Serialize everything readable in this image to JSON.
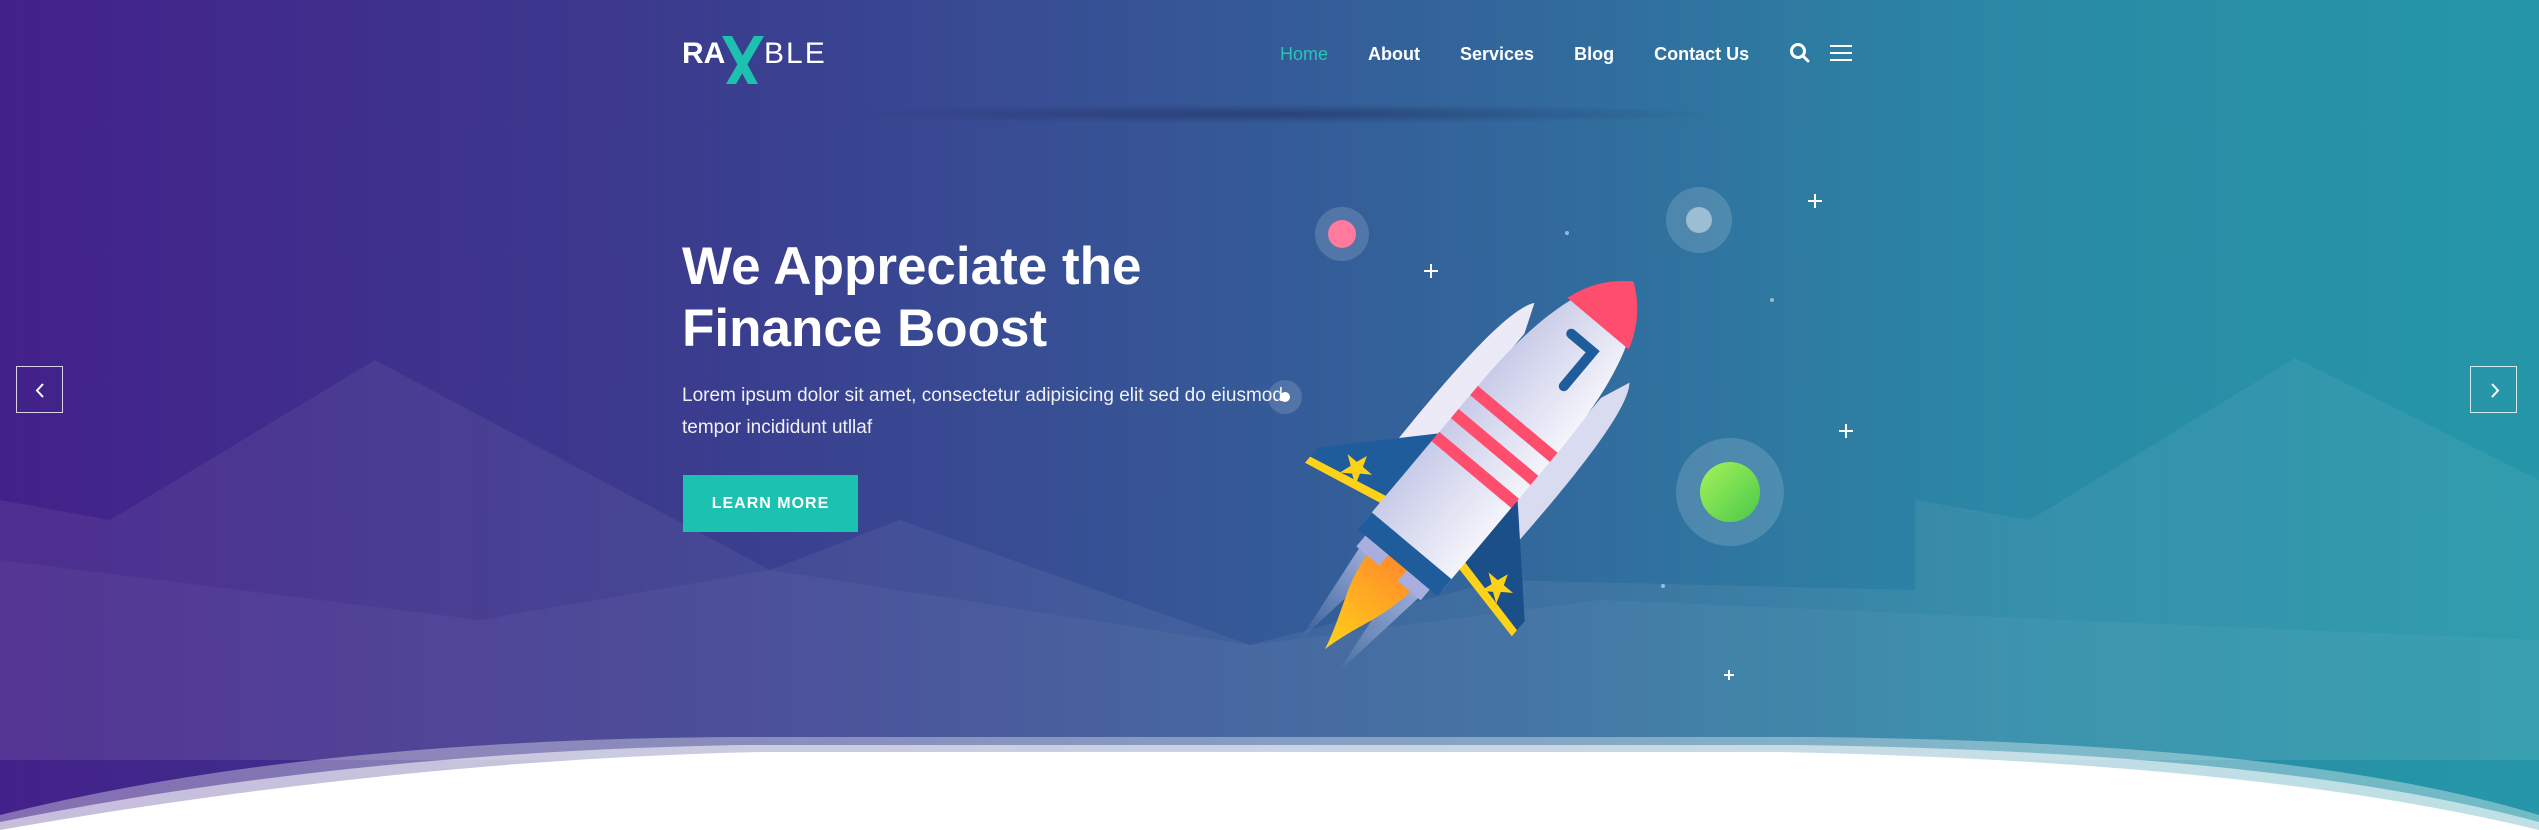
{
  "brand": {
    "logo_text_left": "RA",
    "logo_text_right": "BLE",
    "accent": "#1cc1b0"
  },
  "nav": {
    "items": [
      {
        "label": "Home",
        "active": true
      },
      {
        "label": "About",
        "active": false
      },
      {
        "label": "Services",
        "active": false
      },
      {
        "label": "Blog",
        "active": false
      },
      {
        "label": "Contact Us",
        "active": false
      }
    ],
    "icons": [
      "search-icon",
      "menu-icon"
    ]
  },
  "hero": {
    "title_line1": "We Appreciate the",
    "title_line2": "Finance Boost",
    "subtitle": "Lorem ipsum dolor sit amet, consectetur adipisicing elit sed do eiusmod tempor incididunt utllaf",
    "cta_label": "LEARN MORE"
  },
  "slider": {
    "prev_icon": "chevron-left-icon",
    "next_icon": "chevron-right-icon"
  },
  "illustration": {
    "icon": "rocket-icon"
  }
}
